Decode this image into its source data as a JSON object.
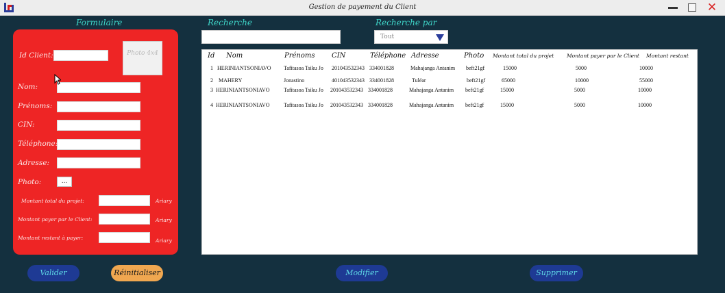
{
  "window": {
    "title": "Gestion de payement du Client",
    "logo_colors": {
      "primary": "#2b3d9b",
      "accent": "#d81f1f"
    }
  },
  "form": {
    "heading": "Formulaire",
    "id_label": "Id Client:",
    "photo_placeholder": "Photo 4x4",
    "nom_label": "Nom:",
    "prenoms_label": "Prénoms:",
    "cin_label": "CIN:",
    "telephone_label": "Téléphone:",
    "adresse_label": "Adresse:",
    "photo_label": "Photo:",
    "browse_label": "...",
    "montant_total_label": "Montant total du projet:",
    "montant_payer_label": "Montant payer par le Client:",
    "montant_restant_label": "Montant restant à payer:",
    "currency": "Ariary",
    "panel_color": "#ee2525"
  },
  "search": {
    "label": "Recherche",
    "filter_label": "Recherche par",
    "filter_value": "Tout"
  },
  "table": {
    "columns": [
      "Id",
      "Nom",
      "Prénoms",
      "CIN",
      "Téléphone",
      "Adresse",
      "Photo",
      "Montant total du projet",
      "Montant payer par le Client",
      "Montant restant"
    ],
    "rows": [
      [
        "1",
        "HERINIANTSONIAVO",
        "Tafitasoa Tsiku Jo",
        "201043532343",
        "334001828",
        "Mahajanga Antanim",
        "beft21gf",
        "15000",
        "5000",
        "10000"
      ],
      [
        "2",
        "MAHERY",
        "Jonastino",
        "401043532343",
        "334001828",
        "Tuléar",
        "beft21gf",
        "65000",
        "10000",
        "55000"
      ],
      [
        "3",
        "HERINIANTSONIAVO",
        "Tafitasoa Tsiku Jo",
        "201043532343",
        "334001828",
        "Mahajanga Antanim",
        "beft21gf",
        "15000",
        "5000",
        "10000"
      ],
      [
        "4",
        "HERINIANTSONIAVO",
        "Tafitasoa Tsiku Jo",
        "201043532343",
        "334001828",
        "Mahajanga Antanim",
        "beft21gf",
        "15000",
        "5000",
        "10000"
      ]
    ]
  },
  "buttons": {
    "valider": "Valider",
    "reinitialiser": "Réinitialiser",
    "modifier": "Modifier",
    "supprimer": "Supprimer"
  },
  "colors": {
    "background": "#14303f",
    "accent_text": "#3fd6c9",
    "button_blue": "#1e3a94",
    "button_orange": "#f0a750"
  }
}
